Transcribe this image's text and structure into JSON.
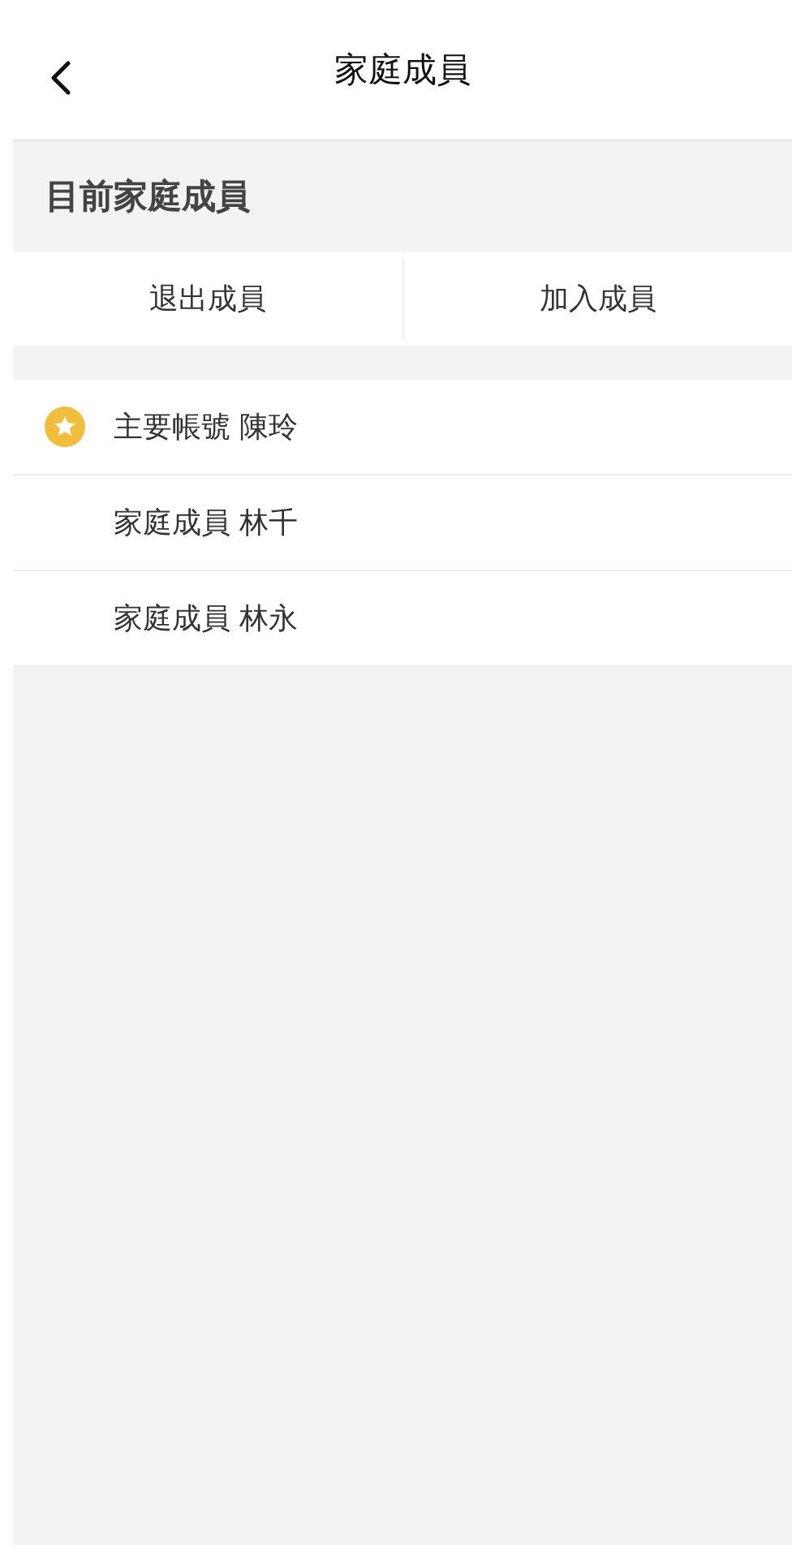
{
  "header": {
    "title": "家庭成員"
  },
  "section": {
    "title": "目前家庭成員"
  },
  "actions": [
    "退出成員",
    "加入成員"
  ],
  "members": [
    {
      "label": "主要帳號 陳玲",
      "primary": true
    },
    {
      "label": "家庭成員 林千",
      "primary": false
    },
    {
      "label": "家庭成員 林永",
      "primary": false
    }
  ]
}
